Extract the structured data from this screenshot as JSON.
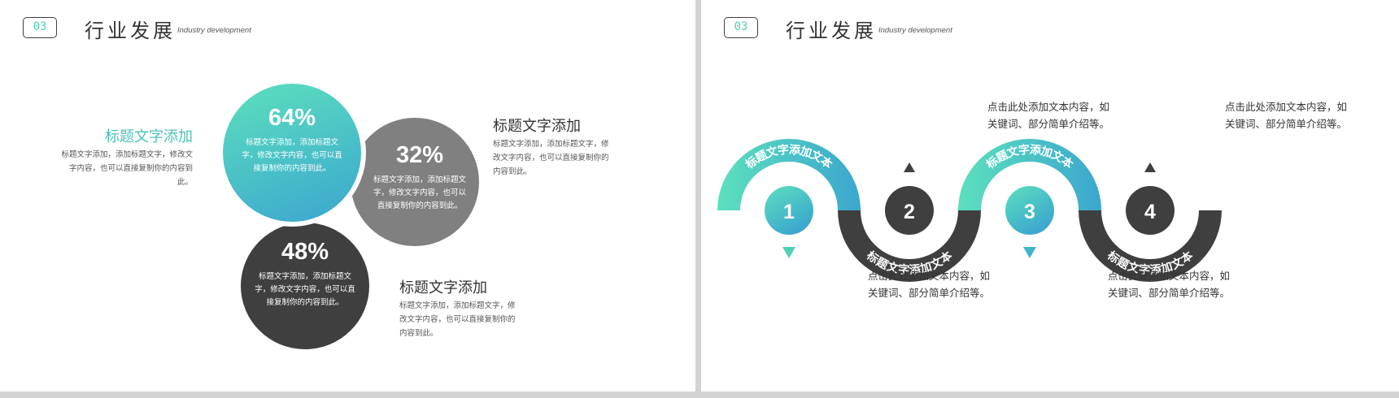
{
  "slide1": {
    "number": "03",
    "title": "行业发展",
    "subtitle": "Industry development",
    "circles": [
      {
        "percent": "64%",
        "text": "标题文字添加，添加标题文字，修改文字内容，也可以直接复制你的内容到此。"
      },
      {
        "percent": "32%",
        "text": "标题文字添加，添加标题文字，修改文字内容，也可以直接复制你的内容到此。"
      },
      {
        "percent": "48%",
        "text": "标题文字添加，添加标题文字，修改文字内容，也可以直接复制你的内容到此。"
      }
    ],
    "blurbs": [
      {
        "title": "标题文字添加",
        "text": "标题文字添加，添加标题文字，修改文字内容，也可以直接复制你的内容到此。"
      },
      {
        "title": "标题文字添加",
        "text": "标题文字添加，添加标题文字，修改文字内容，也可以直接复制你的内容到此。"
      },
      {
        "title": "标题文字添加",
        "text": "标题文字添加，添加标题文字，修改文字内容，也可以直接复制你的内容到此。"
      }
    ]
  },
  "slide2": {
    "number": "03",
    "title": "行业发展",
    "subtitle": "Industry development",
    "steps": [
      {
        "num": "1",
        "arc_label": "标题文字添加文本",
        "text": "点击此处添加文本内容，如关键词、部分简单介绍等。"
      },
      {
        "num": "2",
        "arc_label": "标题文字添加文本",
        "text": "点击此处添加文本内容，如关键词、部分简单介绍等。"
      },
      {
        "num": "3",
        "arc_label": "标题文字添加文本",
        "text": "点击此处添加文本内容，如关键词、部分简单介绍等。"
      },
      {
        "num": "4",
        "arc_label": "标题文字添加文本",
        "text": "点击此处添加文本内容，如关键词、部分简单介绍等。"
      }
    ]
  },
  "colors": {
    "teal_start": "#5ce0bd",
    "teal_end": "#3ba6cf",
    "dark": "#3f3f3f",
    "grey": "#808080",
    "accent_text": "#4cc2b6"
  }
}
